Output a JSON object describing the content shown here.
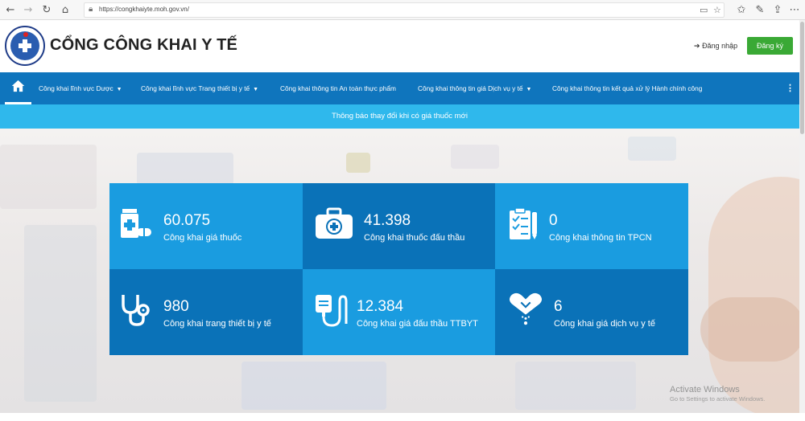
{
  "browser": {
    "url": "https://congkhaiyte.moh.gov.vn/"
  },
  "header": {
    "title": "CỔNG CÔNG KHAI Y TẾ",
    "login_label": "Đăng nhập",
    "register_label": "Đăng ký",
    "logo_text": "BỘ Y TẾ"
  },
  "nav": {
    "items": [
      {
        "label": "Công khai lĩnh vực Dược",
        "caret": "▼"
      },
      {
        "label": "Công khai lĩnh vực Trang thiết bị y tế",
        "caret": "▼"
      },
      {
        "label": "Công khai thông tin An toàn thực phẩm",
        "caret": ""
      },
      {
        "label": "Công khai thông tin giá Dịch vụ y tế",
        "caret": "▼"
      },
      {
        "label": "Công khai thông tin kết quả xử lý Hành chính công",
        "caret": ""
      }
    ],
    "more": "⋮"
  },
  "notice": {
    "text": "Thông báo thay đổi khi có giá thuốc mới"
  },
  "stats": [
    {
      "value": "60.075",
      "label": "Công khai giá thuốc",
      "icon": "medicine-icon"
    },
    {
      "value": "41.398",
      "label": "Công khai thuốc đấu thầu",
      "icon": "medical-kit-icon"
    },
    {
      "value": "0",
      "label": "Công khai thông tin TPCN",
      "icon": "clipboard-icon"
    },
    {
      "value": "980",
      "label": "Công khai trang thiết bị y tế",
      "icon": "stethoscope-icon"
    },
    {
      "value": "12.384",
      "label": "Công khai giá đấu thầu TTBYT",
      "icon": "iv-drip-icon"
    },
    {
      "value": "6",
      "label": "Công khai giá dịch vụ y tế",
      "icon": "heart-hands-icon"
    }
  ],
  "watermark": {
    "title": "Activate Windows",
    "subtitle": "Go to Settings to activate Windows."
  },
  "colors": {
    "nav_blue": "#0f75bd",
    "notice_blue": "#2fb8ec",
    "tile_light": "#1a9ce0",
    "tile_dark": "#0a72b8",
    "register_green": "#3aa935"
  }
}
